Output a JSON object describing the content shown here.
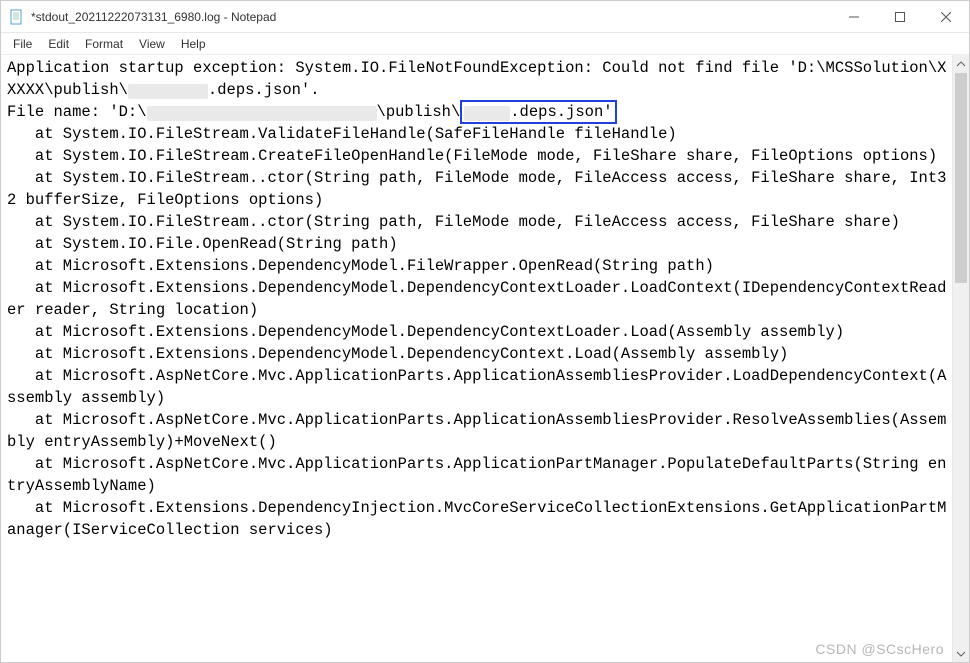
{
  "window": {
    "title": "*stdout_20211222073131_6980.log - Notepad"
  },
  "menu": {
    "file": "File",
    "edit": "Edit",
    "format": "Format",
    "view": "View",
    "help": "Help"
  },
  "log": {
    "l1": "Application startup exception: System.IO.FileNotFoundException: Could not find file 'D:\\MCSSolution\\XXXXX\\publish\\",
    "l1b": ".deps.json'.",
    "l2a": "File name: 'D:\\",
    "l2b": "\\publish\\",
    "l2c": ".deps.json'",
    "l3": "   at System.IO.FileStream.ValidateFileHandle(SafeFileHandle fileHandle)",
    "l4": "   at System.IO.FileStream.CreateFileOpenHandle(FileMode mode, FileShare share, FileOptions options)",
    "l5": "   at System.IO.FileStream..ctor(String path, FileMode mode, FileAccess access, FileShare share, Int32 bufferSize, FileOptions options)",
    "l6": "   at System.IO.FileStream..ctor(String path, FileMode mode, FileAccess access, FileShare share)",
    "l7": "   at System.IO.File.OpenRead(String path)",
    "l8": "   at Microsoft.Extensions.DependencyModel.FileWrapper.OpenRead(String path)",
    "l9": "   at Microsoft.Extensions.DependencyModel.DependencyContextLoader.LoadContext(IDependencyContextReader reader, String location)",
    "l10": "   at Microsoft.Extensions.DependencyModel.DependencyContextLoader.Load(Assembly assembly)",
    "l11": "   at Microsoft.Extensions.DependencyModel.DependencyContext.Load(Assembly assembly)",
    "l12": "   at Microsoft.AspNetCore.Mvc.ApplicationParts.ApplicationAssembliesProvider.LoadDependencyContext(Assembly assembly)",
    "l13": "   at Microsoft.AspNetCore.Mvc.ApplicationParts.ApplicationAssembliesProvider.ResolveAssemblies(Assembly entryAssembly)+MoveNext()",
    "l14": "   at Microsoft.AspNetCore.Mvc.ApplicationParts.ApplicationPartManager.PopulateDefaultParts(String entryAssemblyName)",
    "l15": "   at Microsoft.Extensions.DependencyInjection.MvcCoreServiceCollectionExtensions.GetApplicationPartManager(IServiceCollection services)"
  },
  "watermark": "CSDN @SCscHero",
  "watermark2": ""
}
